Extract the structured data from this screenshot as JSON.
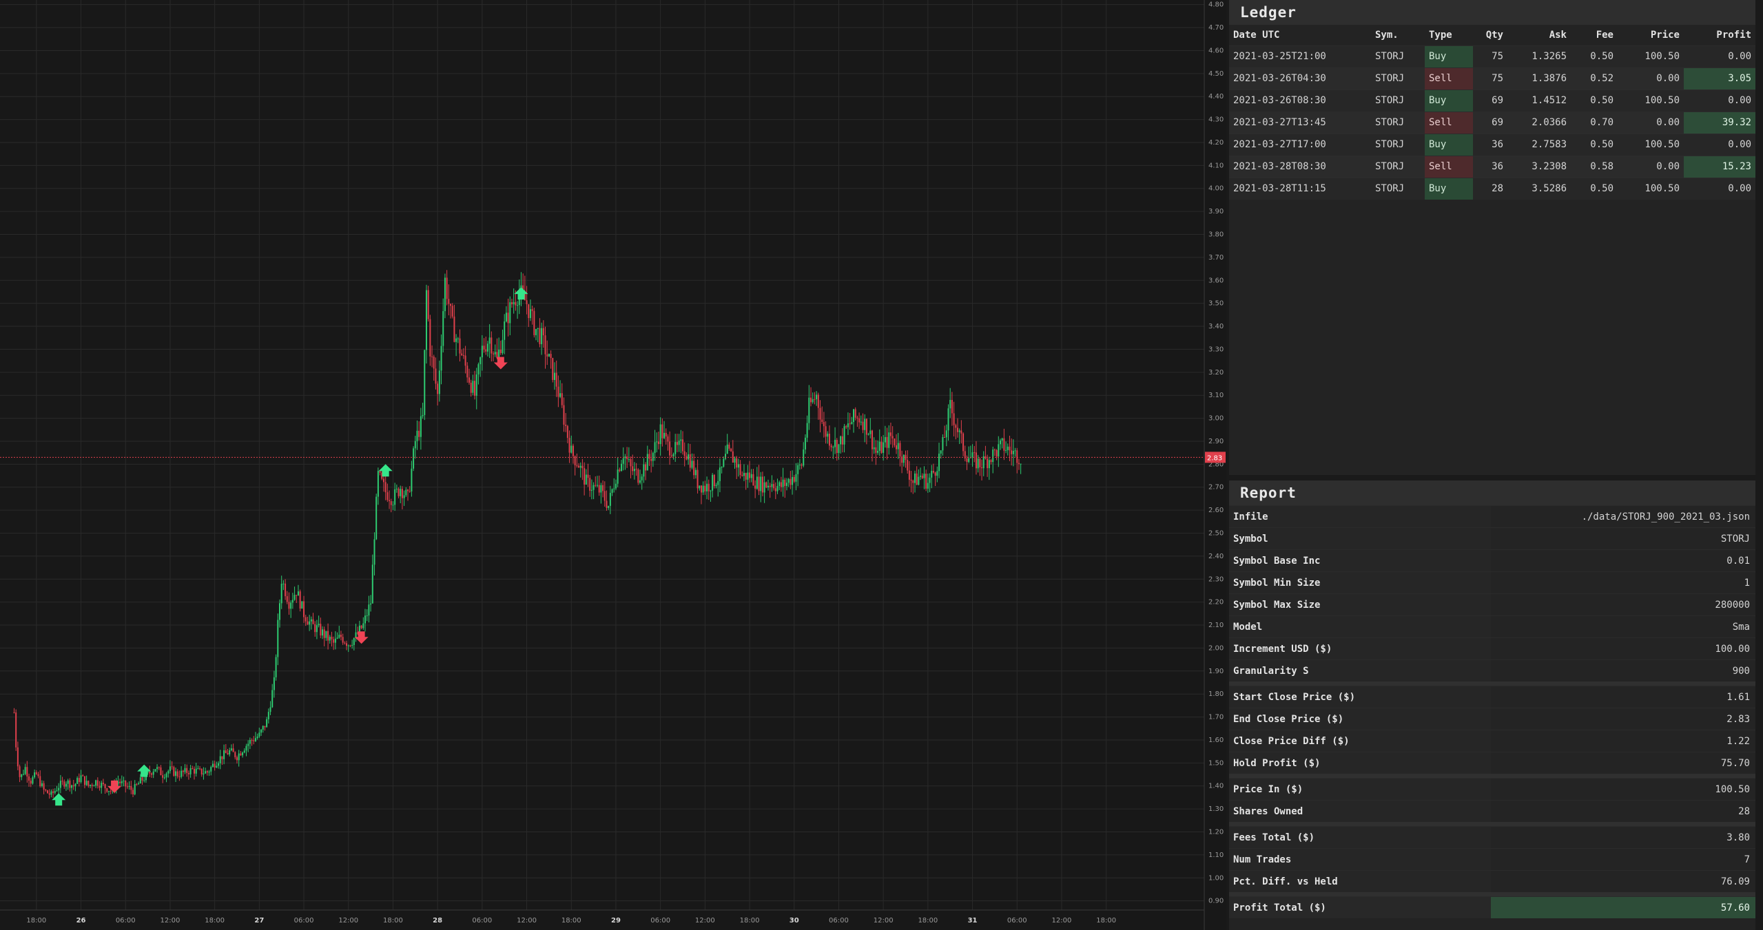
{
  "colors": {
    "up": "#2ecc71",
    "down": "#e0404c",
    "buy_marker": "#36e58a",
    "sell_marker": "#f04455",
    "price_line": "#e0404c",
    "grid": "#2a2a2a",
    "buy_cell": "#2a4a35",
    "sell_cell": "#4e2a2c"
  },
  "chart_data": {
    "type": "candlestick",
    "symbol": "STORJ",
    "granularity_s": 900,
    "ylim": [
      0.86,
      4.82
    ],
    "y_ticks": [
      "0.90",
      "1.00",
      "1.10",
      "1.20",
      "1.30",
      "1.40",
      "1.50",
      "1.60",
      "1.70",
      "1.80",
      "1.90",
      "2.00",
      "2.10",
      "2.20",
      "2.30",
      "2.40",
      "2.50",
      "2.60",
      "2.70",
      "2.80",
      "2.90",
      "3.00",
      "3.10",
      "3.20",
      "3.30",
      "3.40",
      "3.50",
      "3.60",
      "3.70",
      "3.80",
      "3.90",
      "4.00",
      "4.10",
      "4.20",
      "4.30",
      "4.40",
      "4.50",
      "4.60",
      "4.70",
      "4.80"
    ],
    "x_ticks": [
      "18:00",
      "26",
      "06:00",
      "12:00",
      "18:00",
      "27",
      "06:00",
      "12:00",
      "18:00",
      "28",
      "06:00",
      "12:00",
      "18:00",
      "29",
      "06:00",
      "12:00",
      "18:00",
      "30",
      "06:00",
      "12:00",
      "18:00",
      "31",
      "06:00",
      "12:00",
      "18:00"
    ],
    "x_tick_hours": [
      18,
      24,
      30,
      36,
      42,
      48,
      54,
      60,
      66,
      72,
      78,
      84,
      90,
      96,
      102,
      108,
      114,
      120,
      126,
      132,
      138,
      144,
      150,
      156,
      162
    ],
    "x_range_hours": [
      13.1,
      175.2
    ],
    "current_price": "2.83",
    "price_path": [
      [
        15.0,
        1.72
      ],
      [
        15.3,
        1.55
      ],
      [
        15.8,
        1.43
      ],
      [
        16.5,
        1.48
      ],
      [
        17.2,
        1.42
      ],
      [
        18.0,
        1.45
      ],
      [
        19.0,
        1.38
      ],
      [
        20.0,
        1.36
      ],
      [
        21.0,
        1.4
      ],
      [
        22.0,
        1.42
      ],
      [
        23.0,
        1.4
      ],
      [
        24.0,
        1.44
      ],
      [
        25.0,
        1.4
      ],
      [
        26.0,
        1.42
      ],
      [
        27.0,
        1.4
      ],
      [
        28.0,
        1.38
      ],
      [
        29.0,
        1.42
      ],
      [
        30.0,
        1.4
      ],
      [
        31.0,
        1.38
      ],
      [
        32.0,
        1.42
      ],
      [
        33.0,
        1.45
      ],
      [
        34.0,
        1.48
      ],
      [
        35.0,
        1.45
      ],
      [
        36.0,
        1.47
      ],
      [
        37.0,
        1.45
      ],
      [
        38.0,
        1.46
      ],
      [
        39.0,
        1.47
      ],
      [
        40.0,
        1.46
      ],
      [
        41.0,
        1.46
      ],
      [
        42.0,
        1.5
      ],
      [
        43.0,
        1.53
      ],
      [
        44.0,
        1.55
      ],
      [
        45.0,
        1.53
      ],
      [
        46.0,
        1.57
      ],
      [
        47.0,
        1.6
      ],
      [
        48.0,
        1.62
      ],
      [
        49.0,
        1.68
      ],
      [
        50.0,
        1.85
      ],
      [
        50.5,
        2.1
      ],
      [
        51.0,
        2.3
      ],
      [
        52.0,
        2.2
      ],
      [
        53.0,
        2.25
      ],
      [
        54.0,
        2.15
      ],
      [
        55.0,
        2.1
      ],
      [
        56.0,
        2.08
      ],
      [
        57.0,
        2.05
      ],
      [
        58.0,
        2.02
      ],
      [
        59.0,
        2.05
      ],
      [
        60.0,
        2.02
      ],
      [
        61.0,
        2.05
      ],
      [
        62.0,
        2.1
      ],
      [
        63.0,
        2.2
      ],
      [
        63.5,
        2.5
      ],
      [
        64.0,
        2.75
      ],
      [
        65.0,
        2.68
      ],
      [
        66.0,
        2.65
      ],
      [
        67.0,
        2.7
      ],
      [
        68.0,
        2.65
      ],
      [
        69.0,
        2.9
      ],
      [
        70.0,
        3.0
      ],
      [
        70.5,
        3.55
      ],
      [
        71.0,
        3.3
      ],
      [
        72.0,
        3.1
      ],
      [
        73.0,
        3.6
      ],
      [
        74.0,
        3.4
      ],
      [
        75.0,
        3.3
      ],
      [
        76.0,
        3.2
      ],
      [
        77.0,
        3.1
      ],
      [
        78.0,
        3.3
      ],
      [
        79.0,
        3.35
      ],
      [
        80.0,
        3.25
      ],
      [
        81.0,
        3.4
      ],
      [
        82.0,
        3.5
      ],
      [
        83.0,
        3.55
      ],
      [
        84.0,
        3.5
      ],
      [
        85.0,
        3.4
      ],
      [
        86.0,
        3.35
      ],
      [
        87.0,
        3.25
      ],
      [
        88.0,
        3.15
      ],
      [
        89.0,
        3.0
      ],
      [
        90.0,
        2.85
      ],
      [
        91.0,
        2.8
      ],
      [
        92.0,
        2.72
      ],
      [
        93.0,
        2.7
      ],
      [
        94.0,
        2.68
      ],
      [
        95.0,
        2.62
      ],
      [
        96.0,
        2.75
      ],
      [
        97.0,
        2.85
      ],
      [
        98.0,
        2.78
      ],
      [
        99.0,
        2.75
      ],
      [
        100.0,
        2.8
      ],
      [
        101.0,
        2.85
      ],
      [
        102.0,
        2.95
      ],
      [
        103.0,
        2.88
      ],
      [
        104.0,
        2.86
      ],
      [
        105.0,
        2.88
      ],
      [
        106.0,
        2.82
      ],
      [
        107.0,
        2.72
      ],
      [
        108.0,
        2.7
      ],
      [
        109.0,
        2.72
      ],
      [
        110.0,
        2.75
      ],
      [
        111.0,
        2.85
      ],
      [
        112.0,
        2.82
      ],
      [
        113.0,
        2.75
      ],
      [
        114.0,
        2.75
      ],
      [
        115.0,
        2.72
      ],
      [
        116.0,
        2.71
      ],
      [
        117.0,
        2.72
      ],
      [
        118.0,
        2.7
      ],
      [
        119.0,
        2.72
      ],
      [
        120.0,
        2.75
      ],
      [
        121.0,
        2.8
      ],
      [
        122.0,
        3.05
      ],
      [
        123.0,
        3.1
      ],
      [
        124.0,
        2.95
      ],
      [
        125.0,
        2.9
      ],
      [
        126.0,
        2.88
      ],
      [
        127.0,
        2.95
      ],
      [
        128.0,
        3.0
      ],
      [
        129.0,
        3.0
      ],
      [
        130.0,
        2.95
      ],
      [
        131.0,
        2.85
      ],
      [
        132.0,
        2.88
      ],
      [
        133.0,
        2.92
      ],
      [
        134.0,
        2.88
      ],
      [
        135.0,
        2.8
      ],
      [
        136.0,
        2.72
      ],
      [
        137.0,
        2.75
      ],
      [
        138.0,
        2.72
      ],
      [
        139.0,
        2.78
      ],
      [
        140.0,
        2.88
      ],
      [
        141.0,
        3.05
      ],
      [
        142.0,
        2.95
      ],
      [
        143.0,
        2.85
      ],
      [
        144.0,
        2.82
      ],
      [
        145.0,
        2.8
      ],
      [
        146.0,
        2.82
      ],
      [
        147.0,
        2.85
      ],
      [
        148.0,
        2.88
      ],
      [
        149.0,
        2.86
      ],
      [
        150.0,
        2.84
      ],
      [
        150.5,
        2.83
      ]
    ],
    "trades": [
      {
        "type": "Buy",
        "hour": 21.0,
        "price": 1.3265
      },
      {
        "type": "Sell",
        "hour": 28.5,
        "price": 1.3876
      },
      {
        "type": "Buy",
        "hour": 32.5,
        "price": 1.4512
      },
      {
        "type": "Sell",
        "hour": 61.75,
        "price": 2.0366
      },
      {
        "type": "Buy",
        "hour": 65.0,
        "price": 2.7583
      },
      {
        "type": "Sell",
        "hour": 80.5,
        "price": 3.2308
      },
      {
        "type": "Buy",
        "hour": 83.25,
        "price": 3.5286
      }
    ]
  },
  "ledger": {
    "title": "Ledger",
    "columns": [
      "Date UTC",
      "Sym.",
      "Type",
      "Qty",
      "Ask",
      "Fee",
      "Price",
      "Profit"
    ],
    "rows": [
      [
        "2021-03-25T21:00",
        "STORJ",
        "Buy",
        "75",
        "1.3265",
        "0.50",
        "100.50",
        "0.00"
      ],
      [
        "2021-03-26T04:30",
        "STORJ",
        "Sell",
        "75",
        "1.3876",
        "0.52",
        "0.00",
        "3.05"
      ],
      [
        "2021-03-26T08:30",
        "STORJ",
        "Buy",
        "69",
        "1.4512",
        "0.50",
        "100.50",
        "0.00"
      ],
      [
        "2021-03-27T13:45",
        "STORJ",
        "Sell",
        "69",
        "2.0366",
        "0.70",
        "0.00",
        "39.32"
      ],
      [
        "2021-03-27T17:00",
        "STORJ",
        "Buy",
        "36",
        "2.7583",
        "0.50",
        "100.50",
        "0.00"
      ],
      [
        "2021-03-28T08:30",
        "STORJ",
        "Sell",
        "36",
        "3.2308",
        "0.58",
        "0.00",
        "15.23"
      ],
      [
        "2021-03-28T11:15",
        "STORJ",
        "Buy",
        "28",
        "3.5286",
        "0.50",
        "100.50",
        "0.00"
      ]
    ]
  },
  "report": {
    "title": "Report",
    "groups": [
      [
        {
          "label": "Infile",
          "value": "./data/STORJ_900_2021_03.json"
        },
        {
          "label": "Symbol",
          "value": "STORJ"
        },
        {
          "label": "Symbol Base Inc",
          "value": "0.01"
        },
        {
          "label": "Symbol Min Size",
          "value": "1"
        },
        {
          "label": "Symbol Max Size",
          "value": "280000"
        },
        {
          "label": "Model",
          "value": "Sma"
        },
        {
          "label": "Increment USD ($)",
          "value": "100.00"
        },
        {
          "label": "Granularity S",
          "value": "900"
        }
      ],
      [
        {
          "label": "Start Close Price ($)",
          "value": "1.61"
        },
        {
          "label": "End Close Price ($)",
          "value": "2.83"
        },
        {
          "label": "Close Price Diff ($)",
          "value": "1.22"
        },
        {
          "label": "Hold Profit ($)",
          "value": "75.70"
        }
      ],
      [
        {
          "label": "Price In ($)",
          "value": "100.50"
        },
        {
          "label": "Shares Owned",
          "value": "28"
        }
      ],
      [
        {
          "label": "Fees Total ($)",
          "value": "3.80"
        },
        {
          "label": "Num Trades",
          "value": "7"
        },
        {
          "label": "Pct. Diff. vs Held",
          "value": "76.09"
        }
      ],
      [
        {
          "label": "Profit Total ($)",
          "value": "57.60",
          "total": true
        }
      ]
    ]
  }
}
